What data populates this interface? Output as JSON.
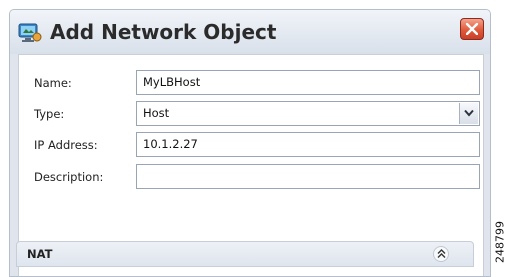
{
  "dialog": {
    "title": "Add Network Object",
    "app_icon": "network-object-icon",
    "close_icon": "close-icon"
  },
  "form": {
    "name": {
      "label": "Name:",
      "value": "MyLBHost"
    },
    "type": {
      "label": "Type:",
      "value": "Host"
    },
    "ip_address": {
      "label": "IP Address:",
      "value": "10.1.2.27"
    },
    "description": {
      "label": "Description:",
      "value": ""
    }
  },
  "nat_section": {
    "label": "NAT",
    "collapse_icon": "double-chevron-up-icon"
  },
  "figure_id": "248799",
  "colors": {
    "window_bg": "#dfe4ed",
    "close_button": "#e05a3a",
    "field_border": "#9aa5b3"
  }
}
